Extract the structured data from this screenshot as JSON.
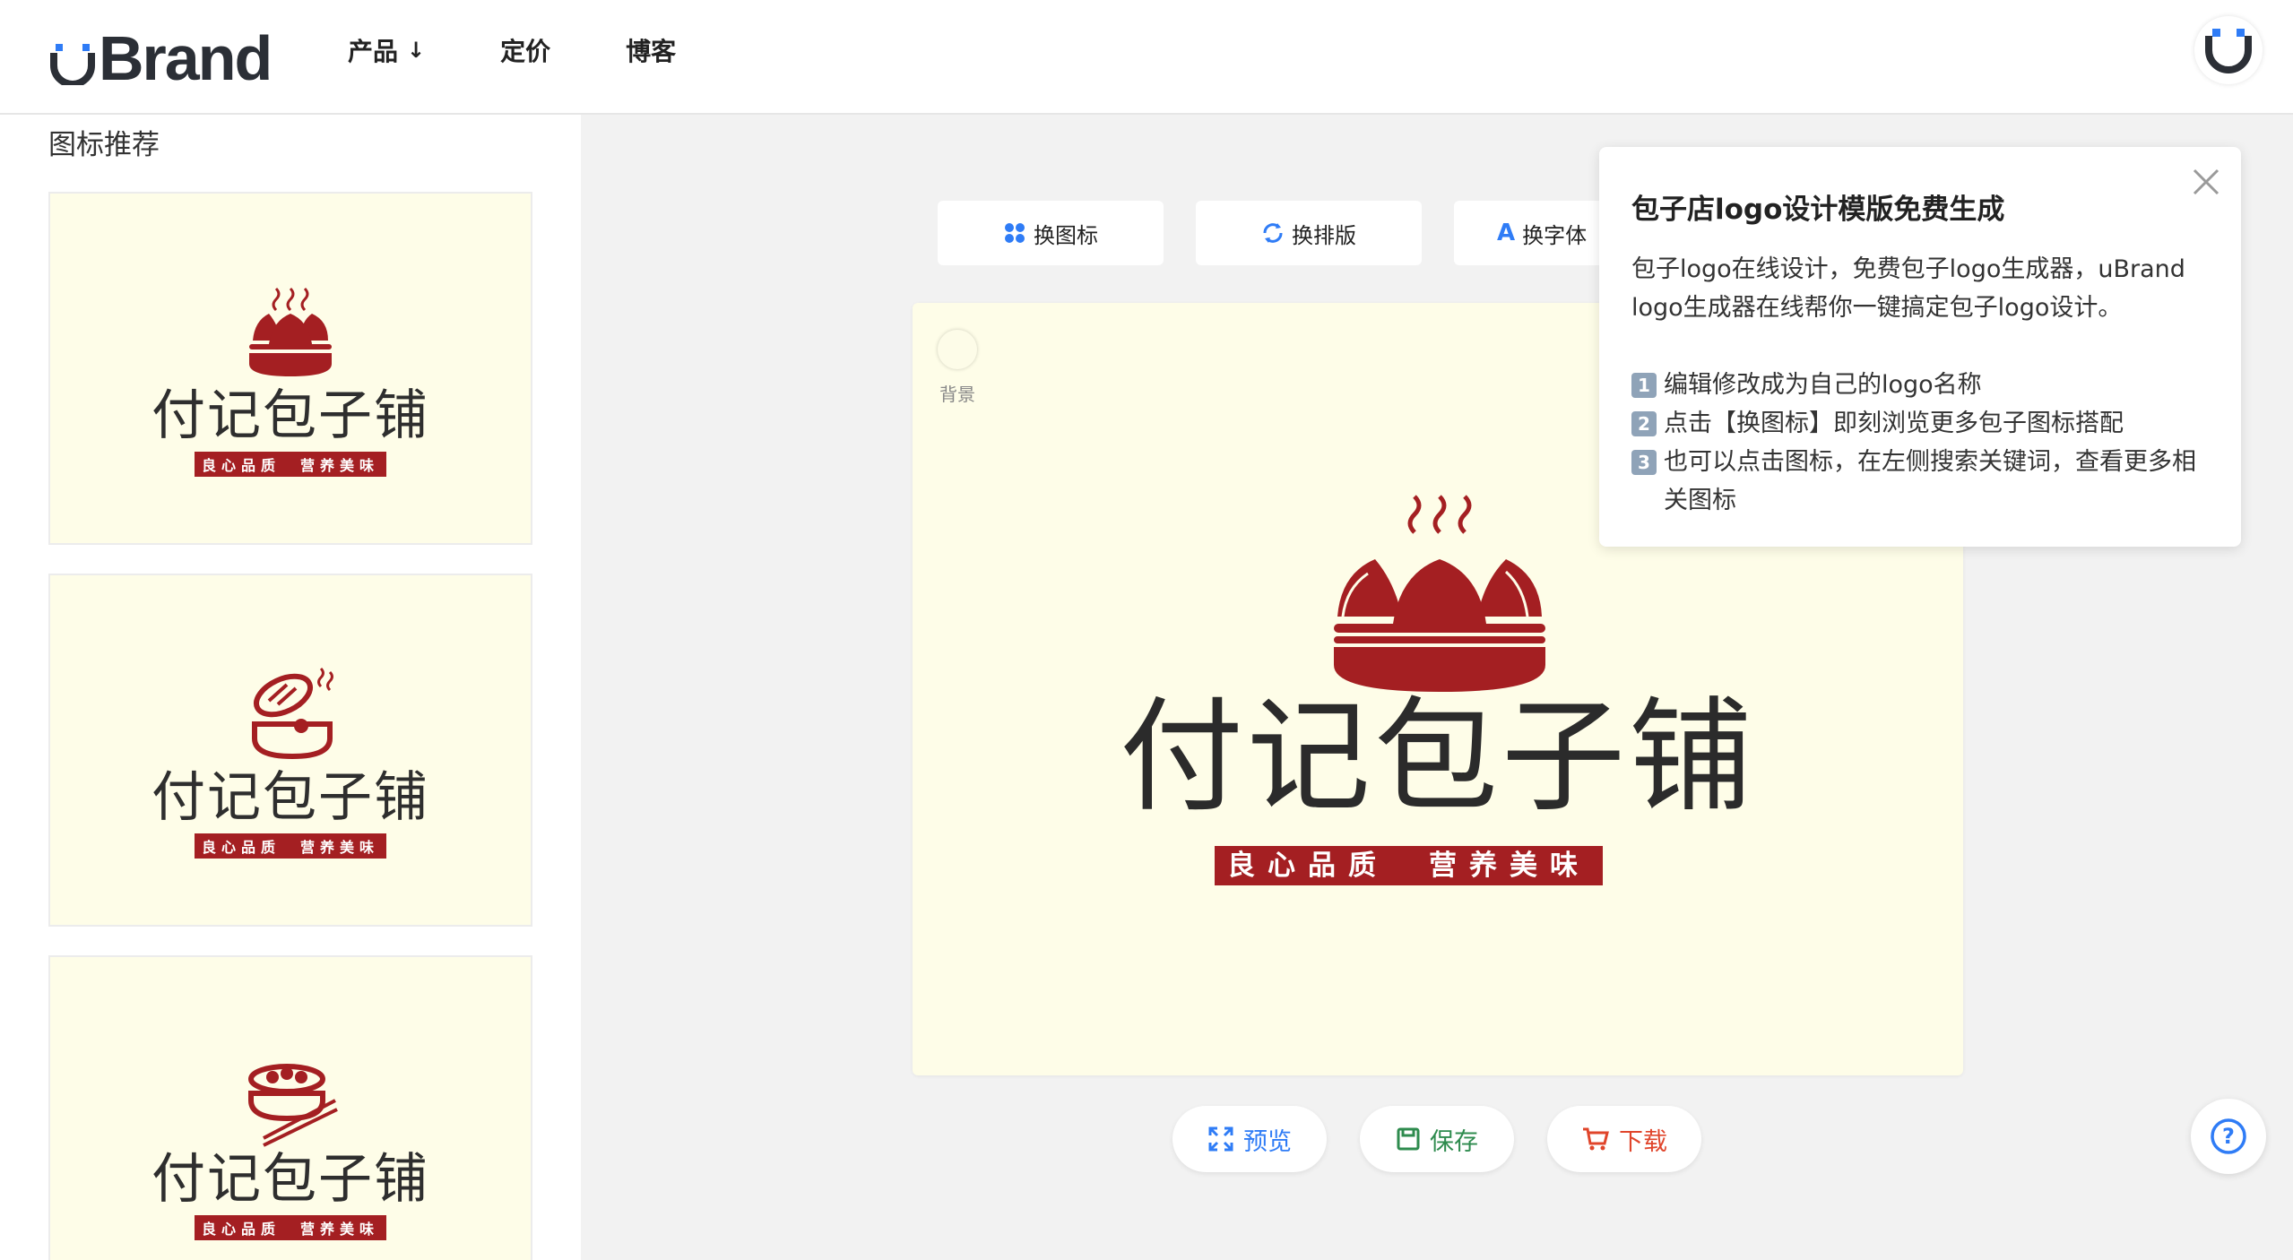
{
  "brand": {
    "name": "Brand",
    "u_prefix": "u"
  },
  "nav": {
    "items": [
      {
        "label": "产品",
        "has_dropdown": true,
        "arrow": "↓"
      },
      {
        "label": "定价"
      },
      {
        "label": "博客"
      }
    ]
  },
  "left_panel": {
    "title": "图标推荐",
    "cards": [
      {
        "icon": "steamed-buns-basket-icon",
        "name": "付记包子铺",
        "slogan": "良心品质　营养美味"
      },
      {
        "icon": "steamer-lid-open-icon",
        "name": "付记包子铺",
        "slogan": "良心品质　营养美味"
      },
      {
        "icon": "bun-bowl-chopsticks-icon",
        "name": "付记包子铺",
        "slogan": "良心品质　营养美味"
      }
    ]
  },
  "toolbar": {
    "change_icon": "换图标",
    "change_layout": "换排版",
    "change_font": "换字体",
    "font_glyph": "A"
  },
  "canvas": {
    "background_label": "背景",
    "background_color": "#fefde8",
    "logo_name": "付记包子铺",
    "slogan": "良心品质　营养美味",
    "accent_color": "#a41f22",
    "icon": "steamed-buns-basket-icon"
  },
  "actions": {
    "preview": "预览",
    "save": "保存",
    "download": "下载",
    "preview_color": "#2f7cf6",
    "save_color": "#2e8b4e",
    "download_color": "#e0452b"
  },
  "popup": {
    "title": "包子店logo设计模版免费生成",
    "intro": "包子logo在线设计，免费包子logo生成器，uBrand logo生成器在线帮你一键搞定包子logo设计。",
    "steps": [
      {
        "num": "1",
        "text": "编辑修改成为自己的logo名称"
      },
      {
        "num": "2",
        "text": "点击【换图标】即刻浏览更多包子图标搭配"
      },
      {
        "num": "3",
        "text": "也可以点击图标，在左侧搜索关键词，查看更多相关图标"
      }
    ]
  },
  "help": {
    "label": "?"
  }
}
